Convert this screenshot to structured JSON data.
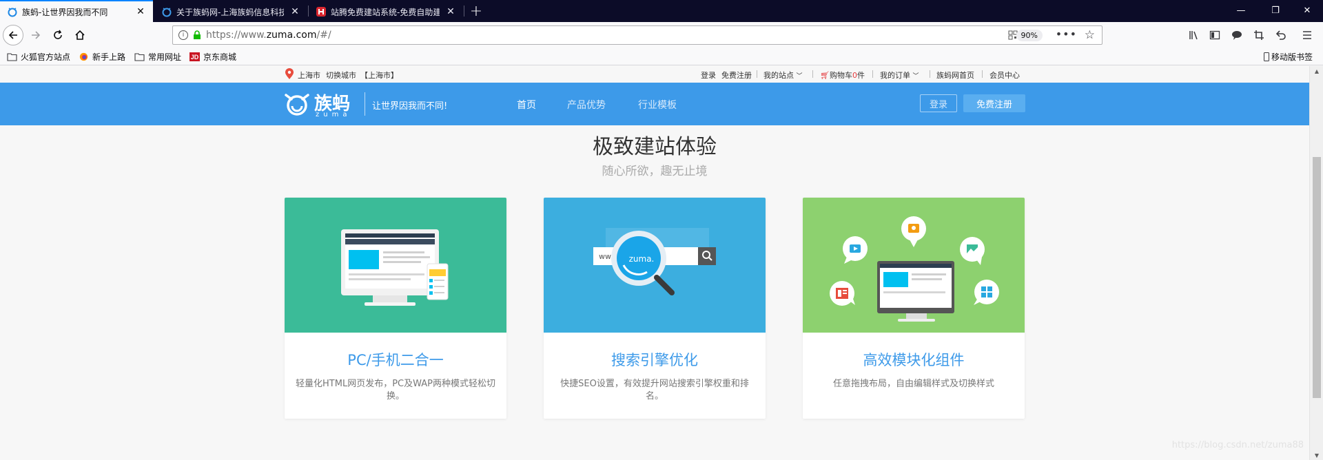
{
  "tabs": [
    {
      "title": "族蚂-让世界因我而不同",
      "icon": "zuma-icon",
      "active": true
    },
    {
      "title": "关于族蚂网-上海族蚂信息科技",
      "icon": "zuma-icon",
      "active": false
    },
    {
      "title": "站腾免费建站系统-免费自助建站",
      "icon": "zhanteng-icon",
      "active": false
    }
  ],
  "new_tab_label": "+",
  "window": {
    "minimize": "—",
    "maximize": "❐",
    "close": "✕"
  },
  "navbar": {
    "url_prefix": "https://www.",
    "url_domain": "zuma.com",
    "url_suffix": "/#/",
    "zoom": "90%"
  },
  "bookmarks": [
    {
      "label": "火狐官方站点",
      "icon": "folder-icon"
    },
    {
      "label": "新手上路",
      "icon": "firefox-icon"
    },
    {
      "label": "常用网址",
      "icon": "folder-icon"
    },
    {
      "label": "京东商城",
      "icon": "jd-icon"
    }
  ],
  "mobile_bookmarks": "移动版书签",
  "topstrip": {
    "city": "上海市",
    "switch_city": "切换城市",
    "current_city": "【上海市】",
    "login": "登录",
    "register": "免费注册",
    "my_site": "我的站点",
    "cart_prefix": "购物车",
    "cart_count": "0",
    "cart_suffix": "件",
    "my_orders": "我的订单",
    "home": "族蚂网首页",
    "member": "会员中心"
  },
  "header": {
    "logo_cn": "族蚂",
    "logo_en": "zuma",
    "slogan": "让世界因我而不同!",
    "nav": [
      "首页",
      "产品优势",
      "行业模板"
    ],
    "login_btn": "登录",
    "register_btn": "免费注册"
  },
  "section": {
    "title": "极致建站体验",
    "subtitle": "随心所欲，趣无止境"
  },
  "cards": [
    {
      "title": "PC/手机二合一",
      "desc": "轻量化HTML网页发布，PC及WAP两种模式轻松切换。",
      "color": "#3bbb98"
    },
    {
      "title": "搜索引擎优化",
      "desc": "快捷SEO设置，有效提升网站搜索引擎权重和排名。",
      "color": "#3caedf",
      "search_text": "ww",
      "magnifier_text": "zuma."
    },
    {
      "title": "高效模块化组件",
      "desc": "任意拖拽布局，自由编辑样式及切换样式",
      "color": "#8dd16f"
    }
  ],
  "watermark": "https://blog.csdn.net/zuma88"
}
